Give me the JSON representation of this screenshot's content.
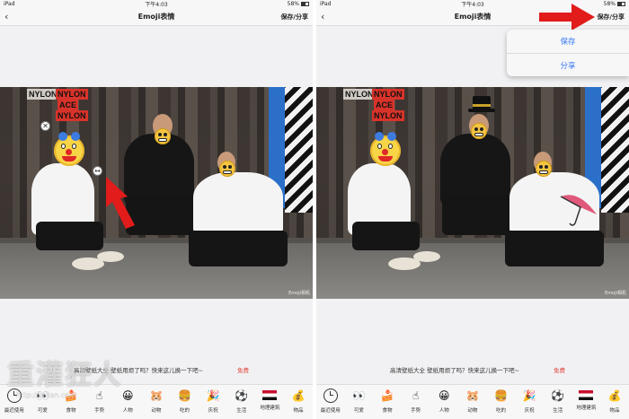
{
  "status": {
    "device": "iPad",
    "time": "下午4:03",
    "battery": "58%"
  },
  "status_right": {
    "device": "iPad",
    "time": "下午4:03",
    "battery": "58%"
  },
  "nav": {
    "title": "Emoji表情",
    "back": "‹",
    "action": "保存/分享"
  },
  "photo": {
    "posters": [
      "NYLON",
      "NYLON",
      "ACE",
      "NYLON"
    ],
    "watermark": "Emoji相机"
  },
  "menu": {
    "items": [
      "保存",
      "分享"
    ]
  },
  "ad": {
    "text": "高清壁纸大全   壁纸用烦了吗？快来这儿换一下吧~",
    "cta": "免费"
  },
  "tabs": [
    {
      "label": "最近使用",
      "icon": "clock-icon",
      "glyph": ""
    },
    {
      "label": "可爱",
      "icon": "cute-eyes-icon",
      "glyph": "👀"
    },
    {
      "label": "食物",
      "icon": "cake-icon",
      "glyph": "🍰"
    },
    {
      "label": "手势",
      "icon": "hand-icon",
      "glyph": "☝"
    },
    {
      "label": "人物",
      "icon": "smiley-icon",
      "glyph": "😀"
    },
    {
      "label": "动物",
      "icon": "hamster-icon",
      "glyph": "🐹"
    },
    {
      "label": "吃的",
      "icon": "burger-icon",
      "glyph": "🍔"
    },
    {
      "label": "庆祝",
      "icon": "party-icon",
      "glyph": "🎉"
    },
    {
      "label": "生活",
      "icon": "soccer-icon",
      "glyph": "⚽"
    },
    {
      "label": "地理建筑",
      "icon": "flag-icon",
      "glyph": ""
    },
    {
      "label": "物品",
      "icon": "money-bag-icon",
      "glyph": "💰"
    }
  ],
  "site_watermark": {
    "text": "重灌狂人",
    "url": "http://briian.com"
  },
  "colors": {
    "accent": "#3478f6",
    "free": "#e0473c",
    "arrow": "#e21b1b"
  }
}
